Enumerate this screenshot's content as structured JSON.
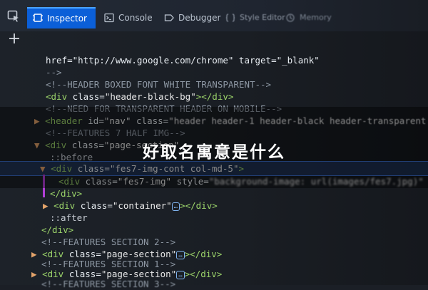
{
  "toolbar": {
    "tabs": {
      "inspector": "Inspector",
      "console": "Console",
      "debugger": "Debugger",
      "style_editor": "Style Editor",
      "memory": "Memory"
    }
  },
  "code": {
    "l1": "href=\"http://www.google.com/chrome\" target=\"_blank\"",
    "l2": "-->",
    "l3": "<!--HEADER BOXED FONT WHITE TRANSPARENT-->",
    "l4_tag": "<div",
    "l4_attr": " class=",
    "l4_val": "\"header-black-bg\"",
    "l4_end": "></div>",
    "l5": "<!--NEED FOR TRANSPARENT HEADER ON MOBILE-->",
    "l6_tag": "<header",
    "l6_attr": " id=",
    "l6_val": "\"nav\"",
    "l6_attr2": " class=",
    "l6_val2": "\"header header-1 header-black header-transparent",
    "l7": "<!--FEATURES 7 HALF IMG-->",
    "l8_tag": "<div",
    "l8_attr": " class=",
    "l8_val": "\"page-section\"",
    "l9": "::before",
    "l10_tag": "<div",
    "l10_attr": " class=",
    "l10_val": "\"fes7-img-cont col-md-5\"",
    "l10_end": ">",
    "l11_tag": "<div",
    "l11_attr": " class=",
    "l11_val": "\"fes7-img\"",
    "l11_attr2": " style=",
    "l11_val2": "\"background-image: url(images/fes7.jpg)\"",
    "l12": "</div>",
    "l13_tag": "<div",
    "l13_attr": " class=",
    "l13_val": "\"container\"",
    "l13_end": "></div>",
    "l14": "::after",
    "l15": "</div>",
    "l16": "<!--FEATURES SECTION 2-->",
    "l17_tag": "<div",
    "l17_attr": " class=",
    "l17_val": "\"page-section\"",
    "l17_end": "></div>",
    "l18": "<!--FEATURES SECTION 1-->",
    "l19_tag": "<div",
    "l19_attr": " class=",
    "l19_val": "\"page-section\"",
    "l19_end": "></div>",
    "l20": "<!--FEATURES SECTION 3-->",
    "ellipsis": "…"
  },
  "overlay": {
    "title": "好取名寓意是什么"
  },
  "icons": {
    "pick": "element-picker-icon",
    "plus": "plus-icon",
    "inspector": "inspector-icon",
    "console": "console-icon",
    "debugger": "debugger-icon",
    "style_editor": "style-editor-icon",
    "memory": "memory-icon"
  },
  "colors": {
    "accent": "#0b5fd8",
    "tag": "#9bd36a",
    "comment": "#8d97a3",
    "highlight": "#3a6cc8"
  }
}
